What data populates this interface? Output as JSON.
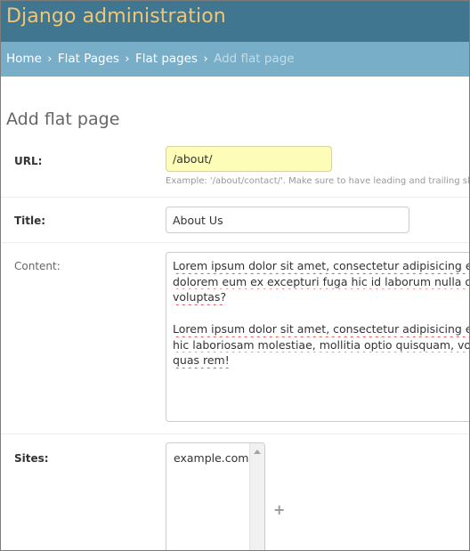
{
  "header": {
    "brand": "Django administration"
  },
  "breadcrumbs": {
    "home": "Home",
    "app": "Flat Pages",
    "model": "Flat pages",
    "current": "Add flat page",
    "separator": "›"
  },
  "page": {
    "title": "Add flat page"
  },
  "form": {
    "url": {
      "label": "URL:",
      "value": "/about/",
      "help": "Example: '/about/contact/'. Make sure to have leading and trailing sla"
    },
    "title": {
      "label": "Title:",
      "value": "About Us"
    },
    "content": {
      "label": "Content:",
      "paragraph1": [
        "Lorem ipsum dolor sit amet, consectetur adipisicing elit. A",
        "dolorem eum ex excepturi fuga hic id laborum nulla optio",
        "voluptas?"
      ],
      "paragraph2": [
        "Lorem ipsum dolor sit amet, consectetur adipisicing elit. A",
        "hic laboriosam molestiae, mollitia optio quisquam, volupta",
        "quas rem!"
      ]
    },
    "sites": {
      "label": "Sites:",
      "options": [
        "example.com"
      ],
      "add_icon": "+"
    }
  },
  "colors": {
    "header_bg": "#417690",
    "brand_text": "#f0c674",
    "breadcrumb_bg": "#79aec8",
    "url_field_bg": "#fdfdb7"
  }
}
